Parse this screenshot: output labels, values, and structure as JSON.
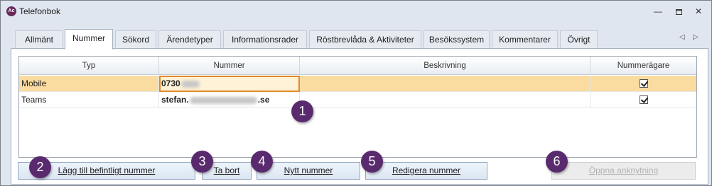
{
  "window": {
    "title": "Telefonbok",
    "app_icon": "Ac",
    "controls": {
      "minimize": "—",
      "maximize": "",
      "close": "✕"
    }
  },
  "tabs": [
    {
      "label": "Allmänt"
    },
    {
      "label": "Nummer"
    },
    {
      "label": "Sökord"
    },
    {
      "label": "Ärendetyper"
    },
    {
      "label": "Informationsrader"
    },
    {
      "label": "Röstbrevlåda & Aktiviteter"
    },
    {
      "label": "Besökssystem"
    },
    {
      "label": "Kommentarer"
    },
    {
      "label": "Övrigt"
    }
  ],
  "tab_scroll": {
    "left": "◁",
    "right": "▷"
  },
  "grid": {
    "columns": [
      "Typ",
      "Nummer",
      "Beskrivning",
      "Nummerägare"
    ],
    "rows": [
      {
        "typ": "Mobile",
        "nummer_prefix": "0730",
        "nummer_suffix": "",
        "beskrivning": "",
        "owner": true,
        "selected": true
      },
      {
        "typ": "Teams",
        "nummer_prefix": "stefan.",
        "nummer_suffix": ".se",
        "beskrivning": "",
        "owner": true,
        "selected": false
      }
    ]
  },
  "buttons": {
    "add_existing": "Lägg till befintligt nummer",
    "remove": "Ta bort",
    "new_number": "Nytt nummer",
    "edit_number": "Redigera nummer",
    "open_link": "Öppna anknytning"
  },
  "callouts": [
    "1",
    "2",
    "3",
    "4",
    "5",
    "6"
  ],
  "colors": {
    "selected_row": "#fbdca0",
    "callout": "#5a2a6e",
    "focus_border": "#e08a2a"
  }
}
